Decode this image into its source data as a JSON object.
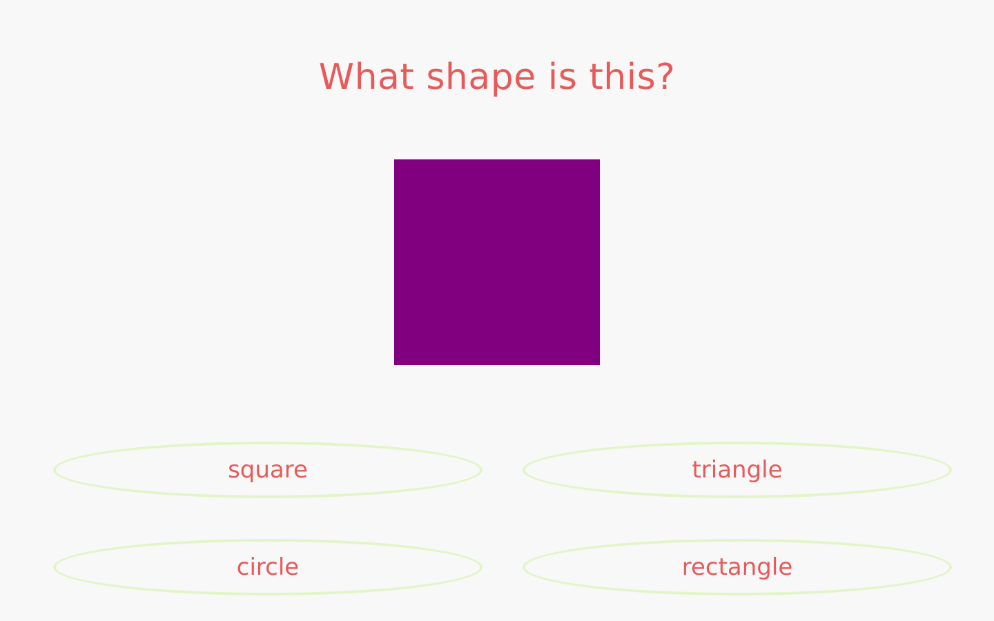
{
  "question": "What shape is this?",
  "shape": {
    "icon": "square-shape",
    "color": "#800080"
  },
  "answers": [
    {
      "label": "square"
    },
    {
      "label": "triangle"
    },
    {
      "label": "circle"
    },
    {
      "label": "rectangle"
    }
  ],
  "colors": {
    "text": "#e85a5a",
    "button_border": "#e2f5c8",
    "background": "#f8f8f8"
  }
}
